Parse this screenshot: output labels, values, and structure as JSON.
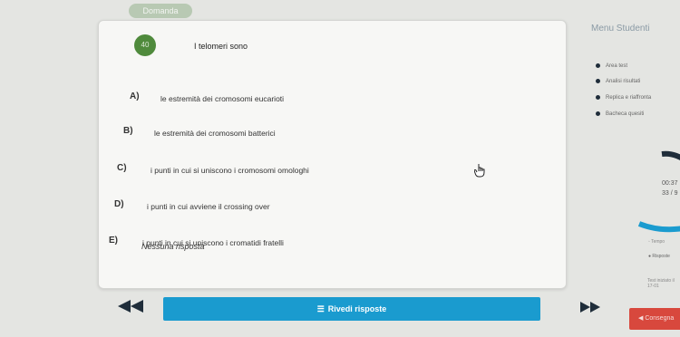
{
  "header": {
    "chip": "Domanda"
  },
  "question": {
    "number": "40",
    "text": "I telomeri sono",
    "options": [
      {
        "letter": "A)",
        "text": "le estremità dei cromosomi eucarioti"
      },
      {
        "letter": "B)",
        "text": "le estremità dei cromosomi batterici"
      },
      {
        "letter": "C)",
        "text": "i punti in cui si uniscono i cromosomi omologhi"
      },
      {
        "letter": "D)",
        "text": "i punti in cui avviene il crossing over"
      },
      {
        "letter": "E)",
        "text": "i punti in cui si uniscono i cromatidi fratelli"
      }
    ],
    "no_answer": "Nessuna risposta"
  },
  "sidebar": {
    "title": "Menu Studenti",
    "items": [
      {
        "label": "Area test"
      },
      {
        "label": "Analisi risultati"
      },
      {
        "label": "Replica e riaffronta"
      },
      {
        "label": "Bacheca quesiti"
      }
    ],
    "time": "00:37",
    "count": "33 / 9",
    "legend": [
      "Tempo",
      "Risposte"
    ],
    "footer": "Test iniziato il 17-01"
  },
  "nav": {
    "review_label": "Rivedi risposte",
    "submit_label": "Consegna"
  },
  "colors": {
    "accent": "#1a9bcf",
    "danger": "#d8483d",
    "badge": "#4f8a3c"
  }
}
